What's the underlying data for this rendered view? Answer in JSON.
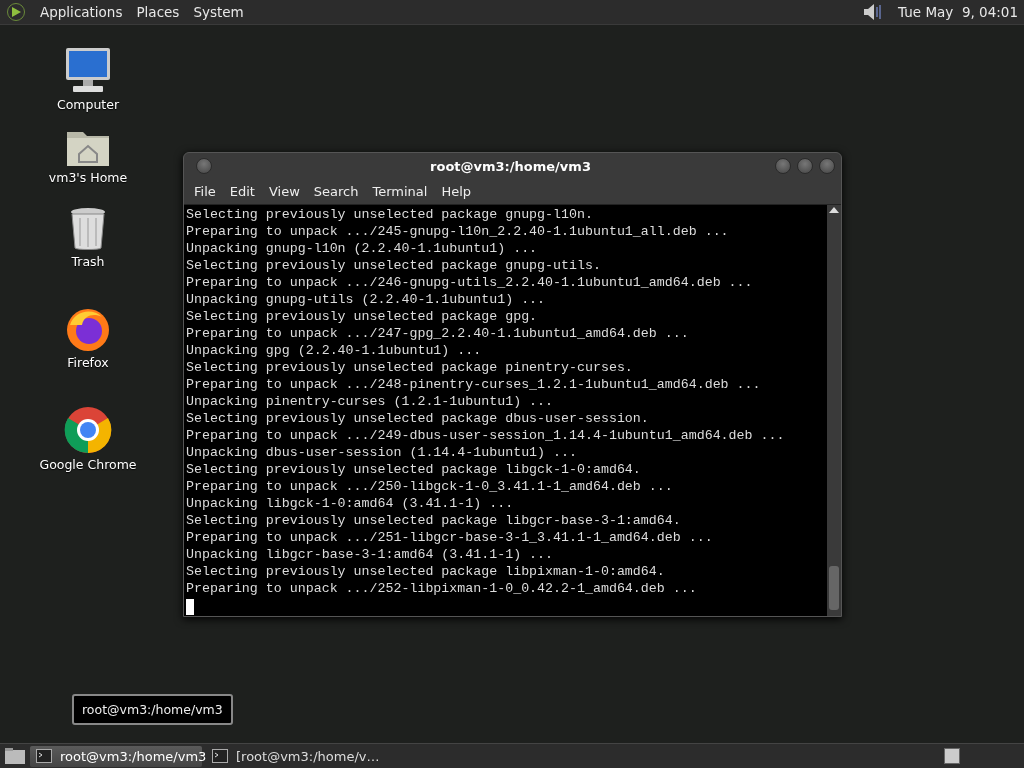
{
  "top_panel": {
    "menus": [
      "Applications",
      "Places",
      "System"
    ],
    "clock": "Tue May  9, 04:01"
  },
  "desktop_icons": [
    {
      "label": "Computer",
      "kind": "computer"
    },
    {
      "label": "vm3's Home",
      "kind": "home"
    },
    {
      "label": "Trash",
      "kind": "trash"
    },
    {
      "label": "Firefox",
      "kind": "firefox"
    },
    {
      "label": "Google Chrome",
      "kind": "chrome"
    }
  ],
  "window": {
    "title": "root@vm3:/home/vm3",
    "menu": [
      "File",
      "Edit",
      "View",
      "Search",
      "Terminal",
      "Help"
    ],
    "lines": [
      "Selecting previously unselected package gnupg-l10n.",
      "Preparing to unpack .../245-gnupg-l10n_2.2.40-1.1ubuntu1_all.deb ...",
      "Unpacking gnupg-l10n (2.2.40-1.1ubuntu1) ...",
      "Selecting previously unselected package gnupg-utils.",
      "Preparing to unpack .../246-gnupg-utils_2.2.40-1.1ubuntu1_amd64.deb ...",
      "Unpacking gnupg-utils (2.2.40-1.1ubuntu1) ...",
      "Selecting previously unselected package gpg.",
      "Preparing to unpack .../247-gpg_2.2.40-1.1ubuntu1_amd64.deb ...",
      "Unpacking gpg (2.2.40-1.1ubuntu1) ...",
      "Selecting previously unselected package pinentry-curses.",
      "Preparing to unpack .../248-pinentry-curses_1.2.1-1ubuntu1_amd64.deb ...",
      "Unpacking pinentry-curses (1.2.1-1ubuntu1) ...",
      "Selecting previously unselected package dbus-user-session.",
      "Preparing to unpack .../249-dbus-user-session_1.14.4-1ubuntu1_amd64.deb ...",
      "Unpacking dbus-user-session (1.14.4-1ubuntu1) ...",
      "Selecting previously unselected package libgck-1-0:amd64.",
      "Preparing to unpack .../250-libgck-1-0_3.41.1-1_amd64.deb ...",
      "Unpacking libgck-1-0:amd64 (3.41.1-1) ...",
      "Selecting previously unselected package libgcr-base-3-1:amd64.",
      "Preparing to unpack .../251-libgcr-base-3-1_3.41.1-1_amd64.deb ...",
      "Unpacking libgcr-base-3-1:amd64 (3.41.1-1) ...",
      "Selecting previously unselected package libpixman-1-0:amd64.",
      "Preparing to unpack .../252-libpixman-1-0_0.42.2-1_amd64.deb ..."
    ]
  },
  "tooltip": "root@vm3:/home/vm3",
  "taskbar": {
    "tasks": [
      {
        "label": "root@vm3:/home/vm3",
        "selected": true
      },
      {
        "label": "[root@vm3:/home/v…",
        "selected": false
      }
    ]
  }
}
